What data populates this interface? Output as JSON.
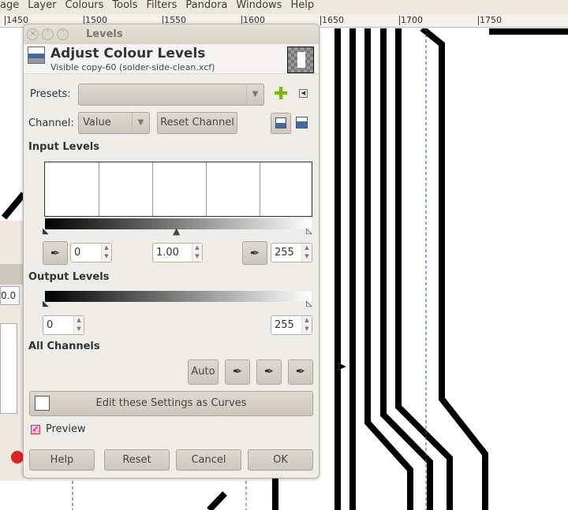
{
  "menubar": [
    "age",
    "Layer",
    "Colours",
    "Tools",
    "Filters",
    "Pandora",
    "Windows",
    "Help"
  ],
  "ruler": [
    "1450",
    "1500",
    "1550",
    "1600",
    "1650",
    "1700",
    "1750"
  ],
  "dialog": {
    "window_title": "Levels",
    "title": "Adjust Colour Levels",
    "subtitle": "Visible copy-60 (solder-side-clean.xcf)",
    "presets_label": "Presets:",
    "presets_value": "",
    "channel_label": "Channel:",
    "channel_value": "Value",
    "reset_channel": "Reset Channel",
    "input_levels": "Input Levels",
    "input_low": "0",
    "input_gamma": "1.00",
    "input_high": "255",
    "output_levels": "Output Levels",
    "output_low": "0",
    "output_high": "255",
    "all_channels": "All Channels",
    "auto": "Auto",
    "edit_curves": "Edit these Settings as Curves",
    "preview_label": "Preview",
    "preview_checked": true,
    "buttons": {
      "help": "Help",
      "reset": "Reset",
      "cancel": "Cancel",
      "ok": "OK"
    }
  },
  "left_panel": {
    "value": "0.0"
  }
}
